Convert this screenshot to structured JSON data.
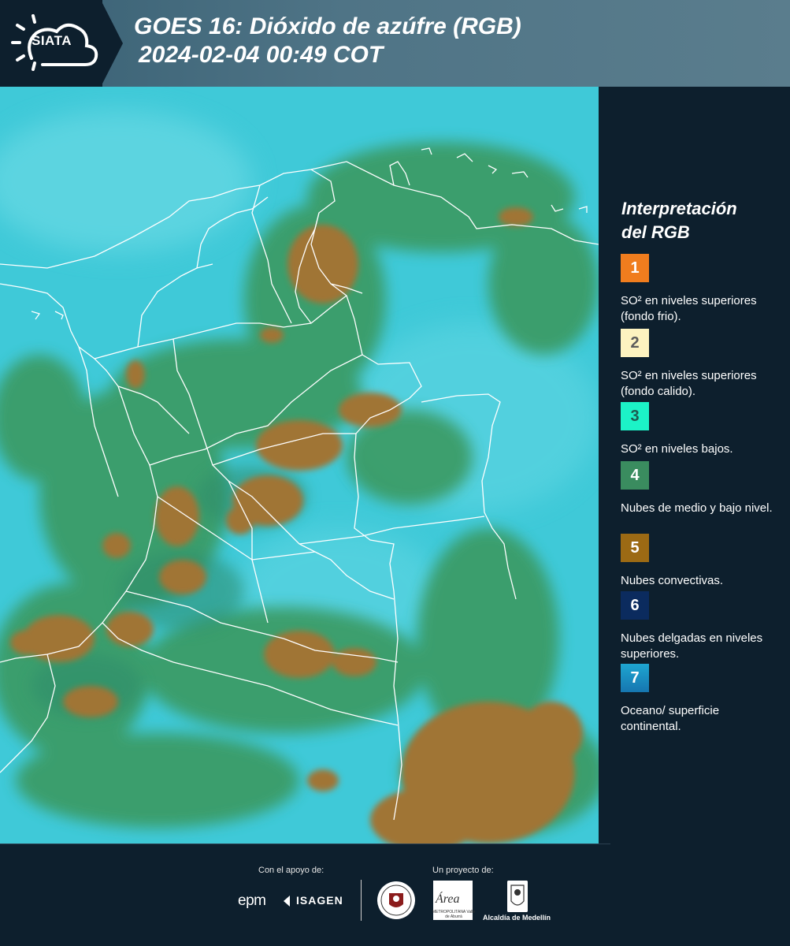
{
  "header": {
    "logo_text": "SIATA",
    "title_line1": "GOES 16: Dióxido de azúfre (RGB)",
    "title_line2": "2024-02-04 00:49 COT"
  },
  "legend": {
    "title_line1": "Interpretación",
    "title_line2": "del RGB",
    "items": [
      {
        "number": "1",
        "color": "#f07d1e",
        "text_color": "#ffffff",
        "label": "SO² en niveles superiores (fondo frio)."
      },
      {
        "number": "2",
        "color": "#fdf3c0",
        "text_color": "#5b5b5b",
        "label": "SO² en niveles superiores (fondo calido)."
      },
      {
        "number": "3",
        "color": "#1cf3c7",
        "text_color": "#1d5b50",
        "label": "SO² en niveles bajos."
      },
      {
        "number": "4",
        "color": "#3a8c5f",
        "text_color": "#ffffff",
        "label": "Nubes de medio y bajo nivel."
      },
      {
        "number": "5",
        "color": "#9c6a14",
        "text_color": "#ffffff",
        "label": "Nubes convectivas."
      },
      {
        "number": "6",
        "color": "#0b2b5e",
        "text_color": "#ffffff",
        "label": "Nubes delgadas en niveles superiores."
      },
      {
        "number": "7",
        "color": "#1e8fc4",
        "text_color": "#ffffff",
        "label": "Oceano/ superficie continental."
      }
    ]
  },
  "footer": {
    "support_label": "Con el apoyo de:",
    "project_label": "Un proyecto de:",
    "epm": "epm",
    "isagen": "ISAGEN",
    "area_text": "Área",
    "area_sub": "METROPOLITANA Valle de Aburrá",
    "alcaldia": "Alcaldía de Medellín"
  },
  "map": {
    "colors": {
      "ocean": "#3fc9d8",
      "low_cloud": "#3a9a62",
      "convective": "#a07534",
      "border": "#ffffff"
    }
  }
}
